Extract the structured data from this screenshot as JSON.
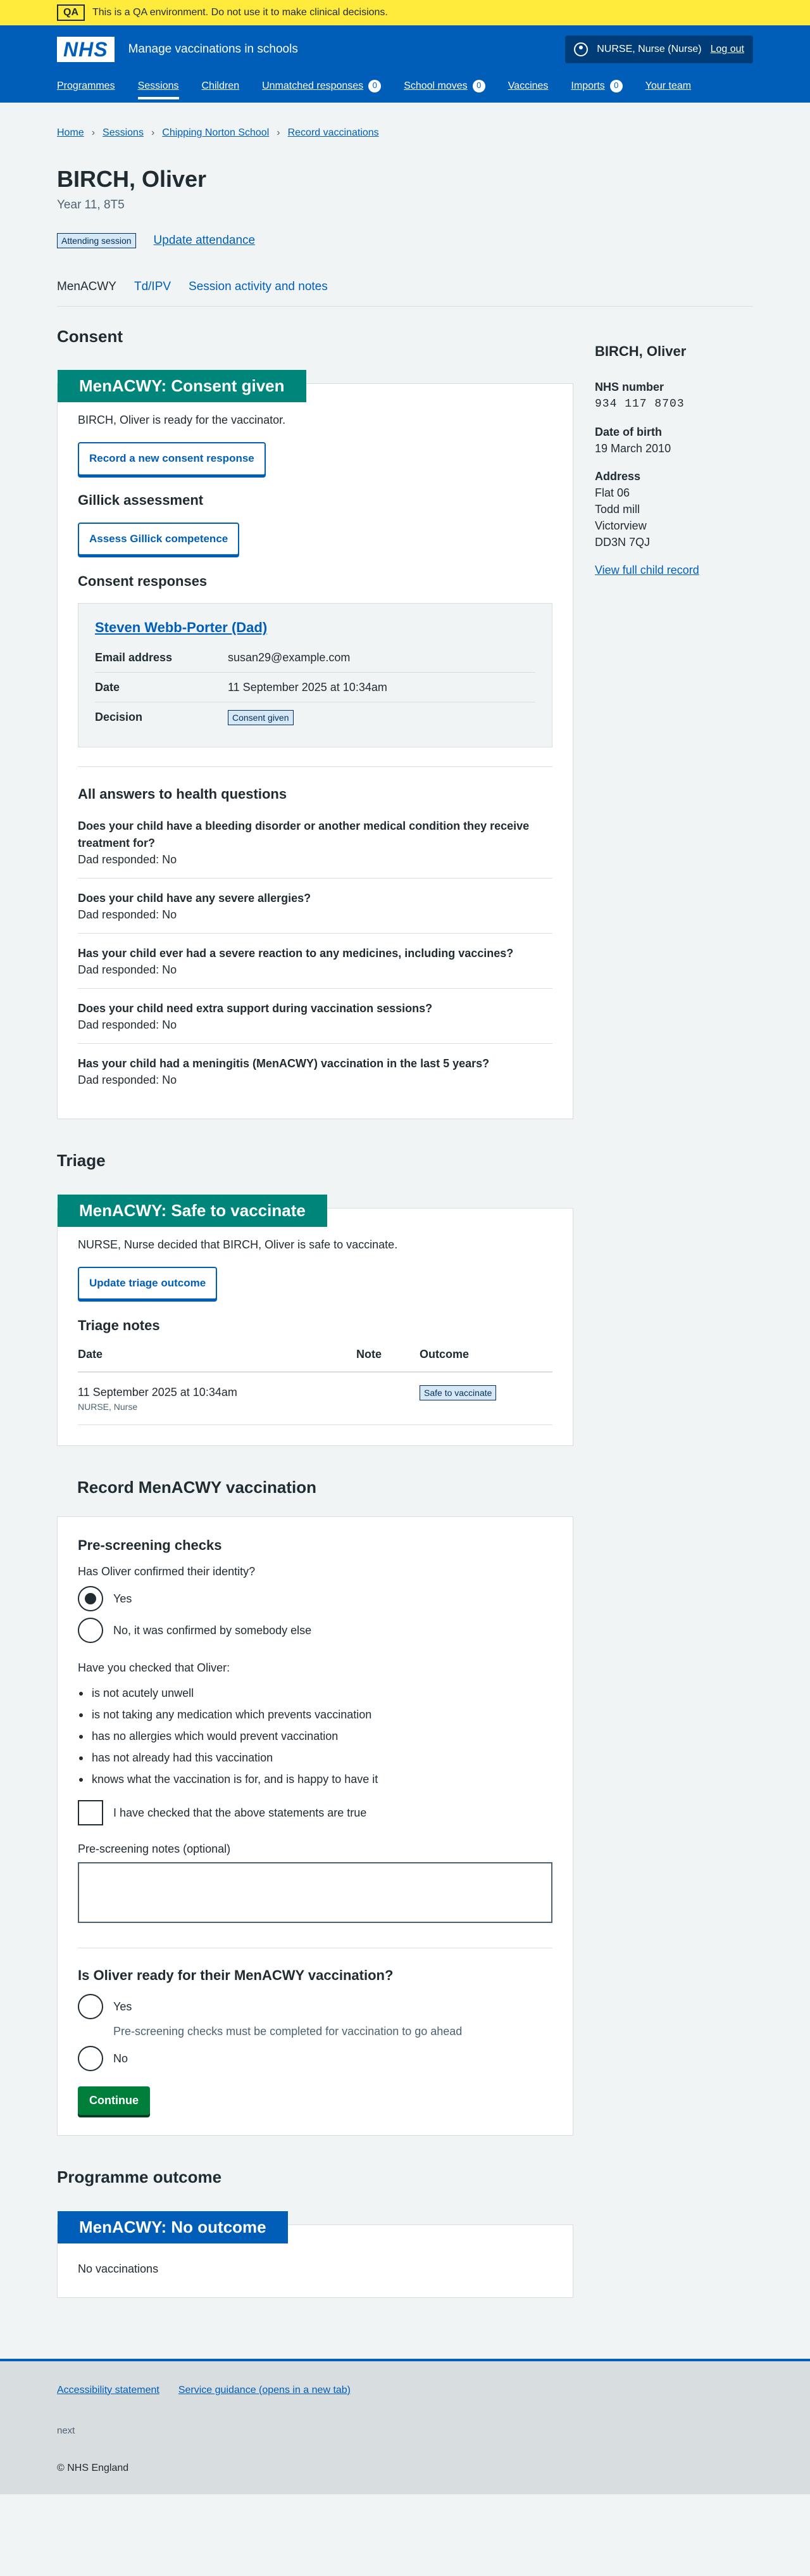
{
  "qa": {
    "tag": "QA",
    "text": "This is a QA environment. Do not use it to make clinical decisions."
  },
  "header": {
    "logo": "NHS",
    "service": "Manage vaccinations in schools",
    "user": "NURSE, Nurse (Nurse)",
    "logout": "Log out",
    "nav": [
      {
        "label": "Programmes"
      },
      {
        "label": "Sessions"
      },
      {
        "label": "Children"
      },
      {
        "label": "Unmatched responses",
        "count": "0"
      },
      {
        "label": "School moves",
        "count": "0"
      },
      {
        "label": "Vaccines"
      },
      {
        "label": "Imports",
        "count": "0"
      },
      {
        "label": "Your team"
      }
    ]
  },
  "breadcrumb": [
    "Home",
    "Sessions",
    "Chipping Norton School",
    "Record vaccinations"
  ],
  "patient": {
    "name": "BIRCH, Oliver",
    "year": "Year 11, 8T5",
    "attendance_tag": "Attending session",
    "update_attendance": "Update attendance"
  },
  "tabs": [
    "MenACWY",
    "Td/IPV",
    "Session activity and notes"
  ],
  "consent": {
    "heading": "Consent",
    "card_title": "MenACWY: Consent given",
    "ready_text": "BIRCH, Oliver is ready for the vaccinator.",
    "record_button": "Record a new consent response",
    "gillick_heading": "Gillick assessment",
    "gillick_button": "Assess Gillick competence",
    "responses_heading": "Consent responses",
    "response": {
      "name": "Steven Webb-Porter (Dad)",
      "rows": [
        {
          "key": "Email address",
          "value": "susan29@example.com"
        },
        {
          "key": "Date",
          "value": "11 September 2025 at 10:34am"
        },
        {
          "key": "Decision",
          "value": "Consent given"
        }
      ]
    },
    "health_heading": "All answers to health questions",
    "health_questions": [
      {
        "q": "Does your child have a bleeding disorder or another medical condition they receive treatment for?",
        "a": "Dad responded: No"
      },
      {
        "q": "Does your child have any severe allergies?",
        "a": "Dad responded: No"
      },
      {
        "q": "Has your child ever had a severe reaction to any medicines, including vaccines?",
        "a": "Dad responded: No"
      },
      {
        "q": "Does your child need extra support during vaccination sessions?",
        "a": "Dad responded: No"
      },
      {
        "q": "Has your child had a meningitis (MenACWY) vaccination in the last 5 years?",
        "a": "Dad responded: No"
      }
    ]
  },
  "triage": {
    "heading": "Triage",
    "card_title": "MenACWY: Safe to vaccinate",
    "decision_text": "NURSE, Nurse decided that BIRCH, Oliver is safe to vaccinate.",
    "update_button": "Update triage outcome",
    "notes_heading": "Triage notes",
    "columns": [
      "Date",
      "Note",
      "Outcome"
    ],
    "rows": [
      {
        "date": "11 September 2025 at 10:34am",
        "by": "NURSE, Nurse",
        "note": "",
        "outcome": "Safe to vaccinate"
      }
    ]
  },
  "record": {
    "heading": "Record MenACWY vaccination",
    "prescreen_heading": "Pre-screening checks",
    "identity_q": "Has Oliver confirmed their identity?",
    "identity_options": [
      "Yes",
      "No, it was confirmed by somebody else"
    ],
    "checked_q": "Have you checked that Oliver:",
    "checks": [
      "is not acutely unwell",
      "is not taking any medication which prevents vaccination",
      "has no allergies which would prevent vaccination",
      "has not already had this vaccination",
      "knows what the vaccination is for, and is happy to have it"
    ],
    "confirm_label": "I have checked that the above statements are true",
    "notes_label": "Pre-screening notes (optional)",
    "ready_q": "Is Oliver ready for their MenACWY vaccination?",
    "ready_yes": "Yes",
    "ready_hint": "Pre-screening checks must be completed for vaccination to go ahead",
    "ready_no": "No",
    "continue": "Continue"
  },
  "outcome": {
    "heading": "Programme outcome",
    "card_title": "MenACWY: No outcome",
    "text": "No vaccinations"
  },
  "sidebar": {
    "name": "BIRCH, Oliver",
    "nhs_label": "NHS number",
    "nhs_value": "934 117 8703",
    "dob_label": "Date of birth",
    "dob_value": "19 March 2010",
    "address_label": "Address",
    "address_lines": [
      "Flat 06",
      "Todd mill",
      "Victorview",
      "DD3N 7QJ"
    ],
    "full_record_link": "View full child record"
  },
  "footer": {
    "links": [
      "Accessibility statement",
      "Service guidance (opens in a new tab)"
    ],
    "muted": "next",
    "copyright": "© NHS England"
  },
  "colors": {
    "nhs_blue": "#005eb8",
    "teal": "#00857a",
    "green_button": "#007f3b",
    "qa_yellow": "#ffeb3b"
  }
}
